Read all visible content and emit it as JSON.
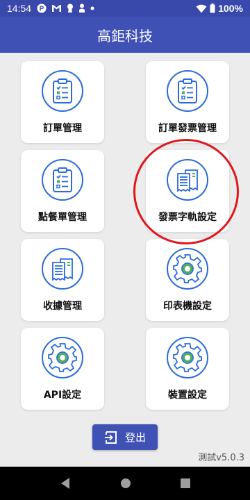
{
  "status_bar": {
    "time": "14:54",
    "battery": "100%",
    "icons": [
      "p-icon",
      "gmail-icon",
      "keyhole-icon",
      "person-icon",
      "dot-icon",
      "wifi-icon",
      "battery-icon"
    ]
  },
  "app_bar": {
    "title": "高鉅科技"
  },
  "menu": {
    "items": [
      {
        "label": "訂單管理",
        "icon": "clipboard-icon"
      },
      {
        "label": "訂單發票管理",
        "icon": "clipboard-icon"
      },
      {
        "label": "點餐單管理",
        "icon": "clipboard-icon"
      },
      {
        "label": "發票字軌設定",
        "icon": "receipt-icon"
      },
      {
        "label": "收據管理",
        "icon": "receipt-icon"
      },
      {
        "label": "印表機設定",
        "icon": "gear-icon"
      },
      {
        "label": "API設定",
        "icon": "gear-icon"
      },
      {
        "label": "裝置設定",
        "icon": "gear-icon"
      }
    ]
  },
  "logout": {
    "label": "登出",
    "icon": "logout-icon"
  },
  "version": "測試v5.0.3",
  "colors": {
    "primary": "#3f51b5",
    "status_bar": "#3949ab",
    "icon_blue": "#2a6bdb",
    "icon_green": "#4caf50",
    "highlight_red": "#e0161d",
    "background": "#ececec"
  }
}
